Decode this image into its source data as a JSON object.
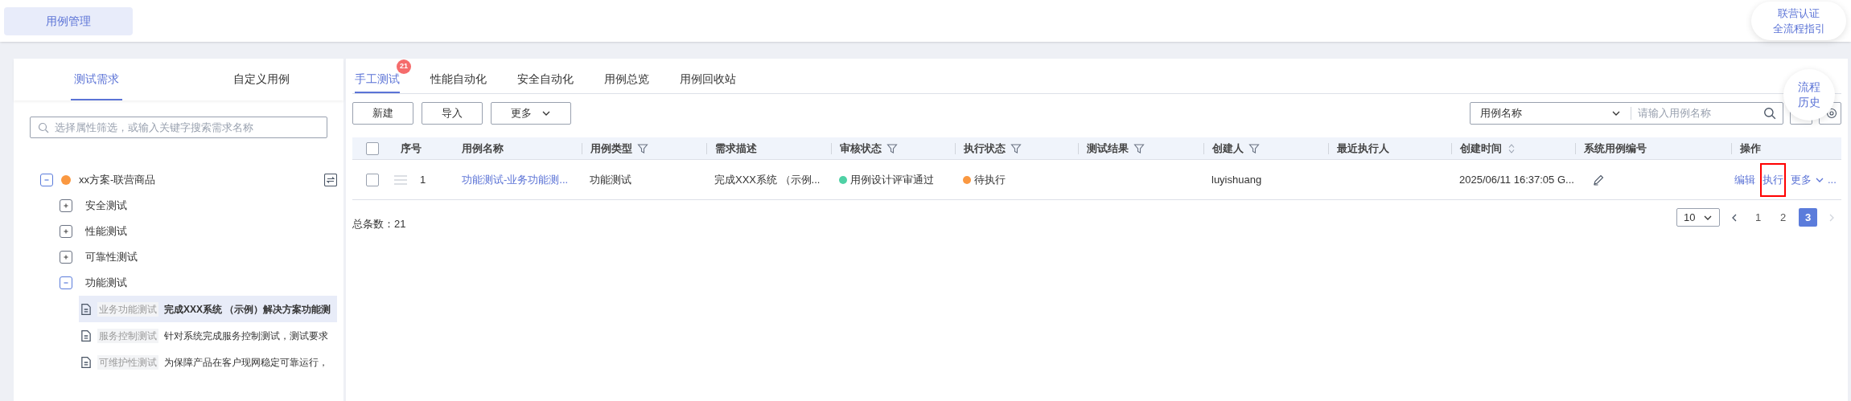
{
  "header": {
    "tab": {
      "label": "用例管理",
      "selected": true
    },
    "guide": [
      "联营认证",
      "全流程指引"
    ]
  },
  "left": {
    "tabs": [
      {
        "label": "测试需求",
        "selected": true
      },
      {
        "label": "自定义用例",
        "selected": false
      }
    ],
    "search": {
      "placeholder": "选择属性筛选，或输入关键字搜索需求名称"
    },
    "tree": {
      "label": "xx方案-联营商品",
      "color": "#fa9841",
      "expanded": true,
      "children": [
        {
          "label": "安全测试",
          "expanded": false
        },
        {
          "label": "性能测试",
          "expanded": false
        },
        {
          "label": "可靠性测试",
          "expanded": false
        },
        {
          "label": "功能测试",
          "expanded": true,
          "children": [
            {
              "tag": "业务功能测试",
              "text": "完成XXX系统 （示例）解决方案功能测",
              "selected": true
            },
            {
              "tag": "服务控制测试",
              "text": "针对系统完成服务控制测试，测试要求",
              "selected": false
            },
            {
              "tag": "可维护性测试",
              "text": "为保障产品在客户现网稳定可靠运行，",
              "selected": false
            }
          ]
        }
      ]
    }
  },
  "main": {
    "tabs": [
      {
        "label": "手工测试",
        "selected": true,
        "badge": "21"
      },
      {
        "label": "性能自动化",
        "selected": false
      },
      {
        "label": "安全自动化",
        "selected": false
      },
      {
        "label": "用例总览",
        "selected": false
      },
      {
        "label": "用例回收站",
        "selected": false
      }
    ],
    "buttons": [
      {
        "label": "新建",
        "kind": "plain"
      },
      {
        "label": "导入",
        "kind": "plain"
      },
      {
        "label": "更多",
        "kind": "dropdown"
      }
    ],
    "search": {
      "field": "用例名称",
      "placeholder": "请输入用例名称"
    },
    "float": [
      "流程",
      "历史"
    ],
    "table": {
      "all_checked": false,
      "columns": [
        {
          "label": "序号",
          "filter": false
        },
        {
          "label": "用例名称",
          "filter": false
        },
        {
          "label": "用例类型",
          "filter": true
        },
        {
          "label": "需求描述",
          "filter": false
        },
        {
          "label": "审核状态",
          "filter": true
        },
        {
          "label": "执行状态",
          "filter": true
        },
        {
          "label": "测试结果",
          "filter": true
        },
        {
          "label": "创建人",
          "filter": true
        },
        {
          "label": "最近执行人",
          "filter": false
        },
        {
          "label": "创建时间",
          "filter": false,
          "sort": true
        },
        {
          "label": "系统用例编号",
          "filter": false
        },
        {
          "label": "操作",
          "filter": false
        }
      ],
      "rows": [
        {
          "checked": false,
          "index": "1",
          "name": "功能测试-业务功能测...",
          "type": "功能测试",
          "desc": "完成XXX系统 （示例...",
          "review": {
            "text": "用例设计评审通过",
            "color": "#4fd1a5"
          },
          "exec": {
            "text": "待执行",
            "color": "#fa9841"
          },
          "creator": "luyishuang",
          "time": "2025/06/11 16:37:05 G...",
          "actions": [
            {
              "label": "编辑",
              "highlighted": false
            },
            {
              "label": "执行",
              "highlighted": true
            },
            {
              "label": "更多",
              "highlighted": false,
              "kind": "dropdown"
            }
          ],
          "more_mark": "..."
        }
      ]
    },
    "total": "总条数：21",
    "pagination": {
      "size": "10",
      "pages": [
        {
          "label": "1",
          "selected": false
        },
        {
          "label": "2",
          "selected": false
        },
        {
          "label": "3",
          "selected": true
        }
      ]
    }
  }
}
